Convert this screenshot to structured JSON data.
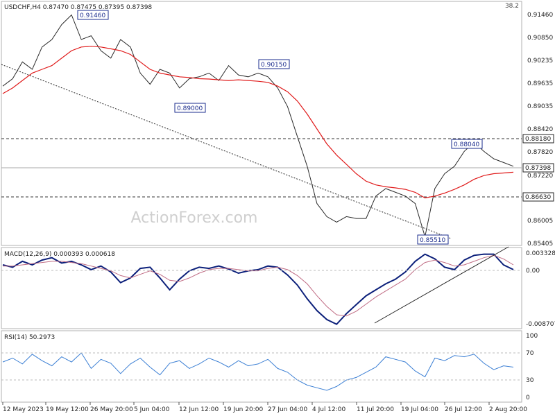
{
  "header": {
    "symbol": "USDCHF,H4",
    "ohlc": "0.87470 0.87475 0.87395 0.87398",
    "corner_value": "38.2"
  },
  "watermark": "ActionForex.com",
  "colors": {
    "price": "#2a2a2a",
    "ema": "#e01b1b",
    "macd_line": "#0b1f7a",
    "signal_line": "#c06c84",
    "rsi": "#3b7fd4",
    "label_border": "#1a2b8c",
    "label_text": "#1a2b8c"
  },
  "main_panel": {
    "y_ticks": [
      "0.91460",
      "0.90850",
      "0.90235",
      "0.89635",
      "0.89035",
      "0.88420",
      "0.87820",
      "0.87220",
      "0.86630",
      "0.86005",
      "0.85405"
    ],
    "current_price_label": "0.87398",
    "level_labels": [
      "0.88180",
      "0.86630"
    ],
    "callouts": [
      "0.91460",
      "0.89000",
      "0.90150",
      "0.88040",
      "0.85510"
    ]
  },
  "macd_panel": {
    "label": "MACD(12,26,9) 0.000393 0.000618",
    "y_ticks": [
      "0.003328",
      "0.00",
      "-0.008707"
    ]
  },
  "rsi_panel": {
    "label": "RSI(14) 50.2973",
    "y_ticks": [
      "100",
      "70",
      "30",
      "0"
    ]
  },
  "x_axis": {
    "labels": [
      "12 May 2023",
      "19 May 12:00",
      "26 May 20:00",
      "5 Jun 04:00",
      "12 Jun 12:00",
      "19 Jun 20:00",
      "27 Jun 04:00",
      "4 Jul 12:00",
      "11 Jul 20:00",
      "19 Jul 04:00",
      "26 Jul 12:00",
      "2 Aug 20:00"
    ]
  },
  "chart_data": [
    {
      "type": "line",
      "panel": "price",
      "y_range": [
        0.8535,
        0.916
      ],
      "series": [
        {
          "name": "Price",
          "values": [
            0.8955,
            0.8975,
            0.902,
            0.9,
            0.906,
            0.908,
            0.912,
            0.9146,
            0.908,
            0.909,
            0.905,
            0.903,
            0.908,
            0.906,
            0.899,
            0.896,
            0.9,
            0.899,
            0.895,
            0.8975,
            0.898,
            0.899,
            0.897,
            0.901,
            0.8985,
            0.898,
            0.899,
            0.898,
            0.895,
            0.89,
            0.882,
            0.874,
            0.864,
            0.8605,
            0.859,
            0.8605,
            0.86,
            0.86,
            0.866,
            0.868,
            0.867,
            0.866,
            0.864,
            0.8551,
            0.868,
            0.872,
            0.874,
            0.878,
            0.8804,
            0.878,
            0.876,
            0.875,
            0.874
          ]
        },
        {
          "name": "EMA",
          "values": [
            0.8935,
            0.895,
            0.897,
            0.899,
            0.9,
            0.901,
            0.903,
            0.905,
            0.906,
            0.9062,
            0.906,
            0.9055,
            0.905,
            0.904,
            0.902,
            0.9,
            0.899,
            0.8985,
            0.898,
            0.8978,
            0.8975,
            0.8974,
            0.8972,
            0.897,
            0.8972,
            0.897,
            0.8968,
            0.8965,
            0.8955,
            0.894,
            0.8915,
            0.888,
            0.884,
            0.88,
            0.877,
            0.8745,
            0.872,
            0.87,
            0.869,
            0.8685,
            0.8682,
            0.8678,
            0.867,
            0.8655,
            0.866,
            0.8668,
            0.8678,
            0.869,
            0.8705,
            0.8715,
            0.872,
            0.8722,
            0.8724
          ]
        }
      ]
    },
    {
      "type": "line",
      "panel": "macd",
      "y_range": [
        -0.0093,
        0.004
      ],
      "series": [
        {
          "name": "MACD",
          "values": [
            0.0012,
            0.0008,
            0.0018,
            0.0012,
            0.002,
            0.0024,
            0.0015,
            0.0018,
            0.0012,
            0.0004,
            0.001,
            0.0,
            -0.0018,
            -0.001,
            0.0006,
            0.0008,
            -0.001,
            -0.003,
            -0.0012,
            0.0002,
            0.0008,
            0.0006,
            0.001,
            0.0005,
            -0.0002,
            0.0002,
            0.0004,
            0.001,
            0.0008,
            -0.0005,
            -0.0022,
            -0.0045,
            -0.0065,
            -0.008,
            -0.0088,
            -0.007,
            -0.0055,
            -0.004,
            -0.003,
            -0.002,
            -0.0012,
            0.0,
            0.0018,
            0.003,
            0.0022,
            0.0008,
            0.0004,
            0.002,
            0.0028,
            0.003,
            0.003,
            0.0012,
            0.0004
          ]
        },
        {
          "name": "Signal",
          "values": [
            0.001,
            0.001,
            0.0012,
            0.0014,
            0.0016,
            0.0018,
            0.0018,
            0.0016,
            0.0014,
            0.001,
            0.0006,
            0.0002,
            -0.0006,
            -0.001,
            -0.0004,
            0.0002,
            -0.0004,
            -0.0014,
            -0.0016,
            -0.001,
            -0.0002,
            0.0004,
            0.0006,
            0.0006,
            0.0004,
            0.0002,
            0.0002,
            0.0006,
            0.0008,
            0.0004,
            -0.0006,
            -0.002,
            -0.004,
            -0.0058,
            -0.0072,
            -0.0074,
            -0.0066,
            -0.0054,
            -0.0042,
            -0.0032,
            -0.0022,
            -0.0012,
            0.0004,
            0.0016,
            0.002,
            0.0016,
            0.001,
            0.0012,
            0.0018,
            0.0024,
            0.0028,
            0.0022,
            0.0012
          ]
        }
      ]
    },
    {
      "type": "line",
      "panel": "rsi",
      "y_range": [
        0,
        100
      ],
      "series": [
        {
          "name": "RSI",
          "values": [
            58,
            64,
            55,
            70,
            60,
            52,
            66,
            58,
            72,
            48,
            62,
            56,
            40,
            55,
            64,
            50,
            38,
            56,
            60,
            48,
            55,
            64,
            58,
            50,
            60,
            52,
            55,
            62,
            48,
            42,
            30,
            22,
            18,
            14,
            20,
            30,
            34,
            42,
            50,
            66,
            62,
            58,
            44,
            35,
            64,
            60,
            68,
            66,
            70,
            56,
            46,
            52,
            50
          ]
        }
      ]
    }
  ]
}
